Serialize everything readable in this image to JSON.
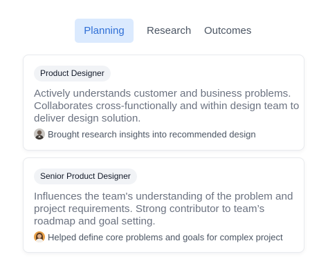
{
  "tabs": [
    {
      "label": "Planning",
      "active": true
    },
    {
      "label": "Research",
      "active": false
    },
    {
      "label": "Outcomes",
      "active": false
    }
  ],
  "cards": [
    {
      "role": "Product Designer",
      "description": "Actively understands customer and business problems. Collaborates cross-functionally and within design team to deliver design solution.",
      "footer": "Brought research insights into recommended design",
      "avatar_icon": "user-avatar-man-icon"
    },
    {
      "role": "Senior Product Designer",
      "description": "Influences the team's understanding of the problem and project requirements. Strong contributor to team’s roadmap and goal setting.",
      "footer": "Helped define core problems and goals for complex project",
      "avatar_icon": "user-avatar-woman-icon"
    }
  ],
  "colors": {
    "active_tab_bg": "#dbeafe",
    "active_tab_text": "#2f6fd6",
    "body_text": "#6b7280",
    "badge_bg": "#f1f3f6"
  }
}
